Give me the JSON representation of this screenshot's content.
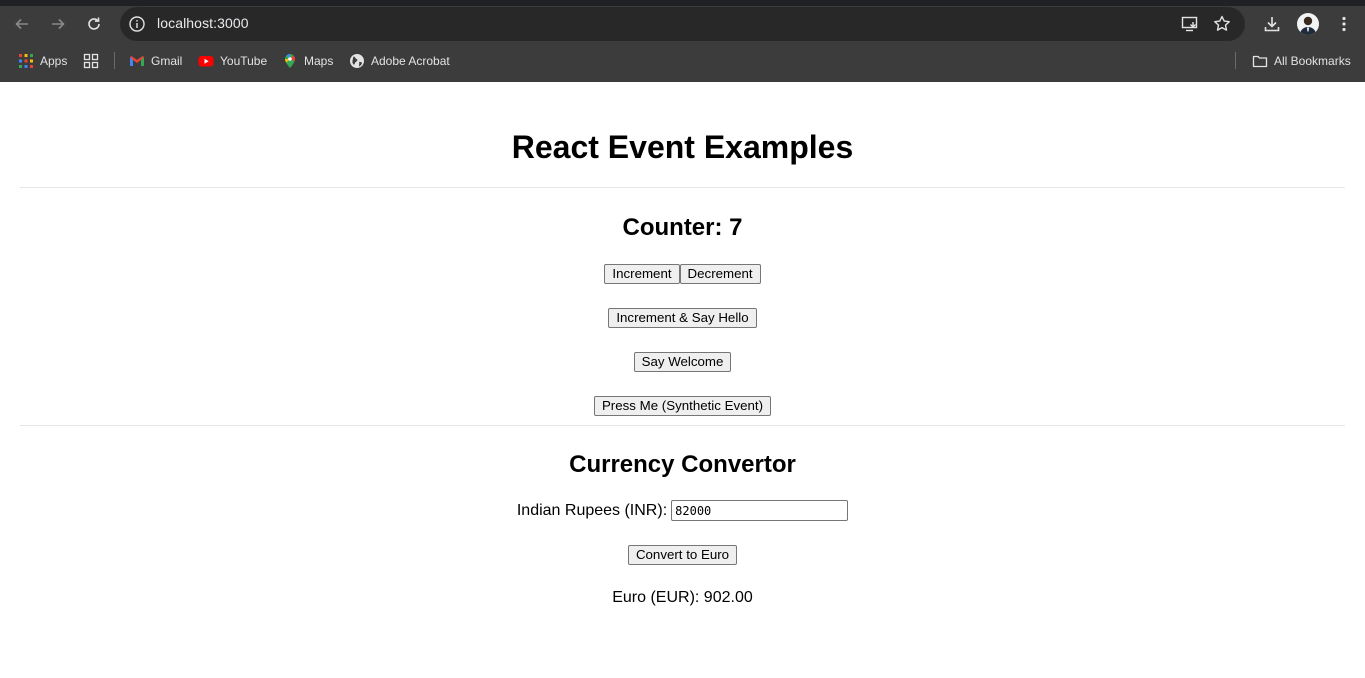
{
  "browser": {
    "url": "localhost:3000",
    "bookmarks": {
      "apps": "Apps",
      "gmail": "Gmail",
      "youtube": "YouTube",
      "maps": "Maps",
      "adobe": "Adobe Acrobat",
      "all_bookmarks": "All Bookmarks"
    }
  },
  "page": {
    "title": "React Event Examples",
    "counter_label": "Counter: 7",
    "buttons": {
      "increment": "Increment",
      "decrement": "Decrement",
      "increment_hello": "Increment & Say Hello",
      "say_welcome": "Say Welcome",
      "press_me": "Press Me (Synthetic Event)",
      "convert": "Convert to Euro"
    },
    "currency": {
      "title": "Currency Convertor",
      "inr_label": "Indian Rupees (INR):",
      "inr_value": "82000",
      "eur_label": "Euro (EUR): 902.00"
    }
  },
  "colors": {
    "chrome_bg": "#3c3c3c",
    "omnibox_bg": "#282828",
    "page_bg": "#ffffff",
    "button_bg": "#efefef"
  }
}
